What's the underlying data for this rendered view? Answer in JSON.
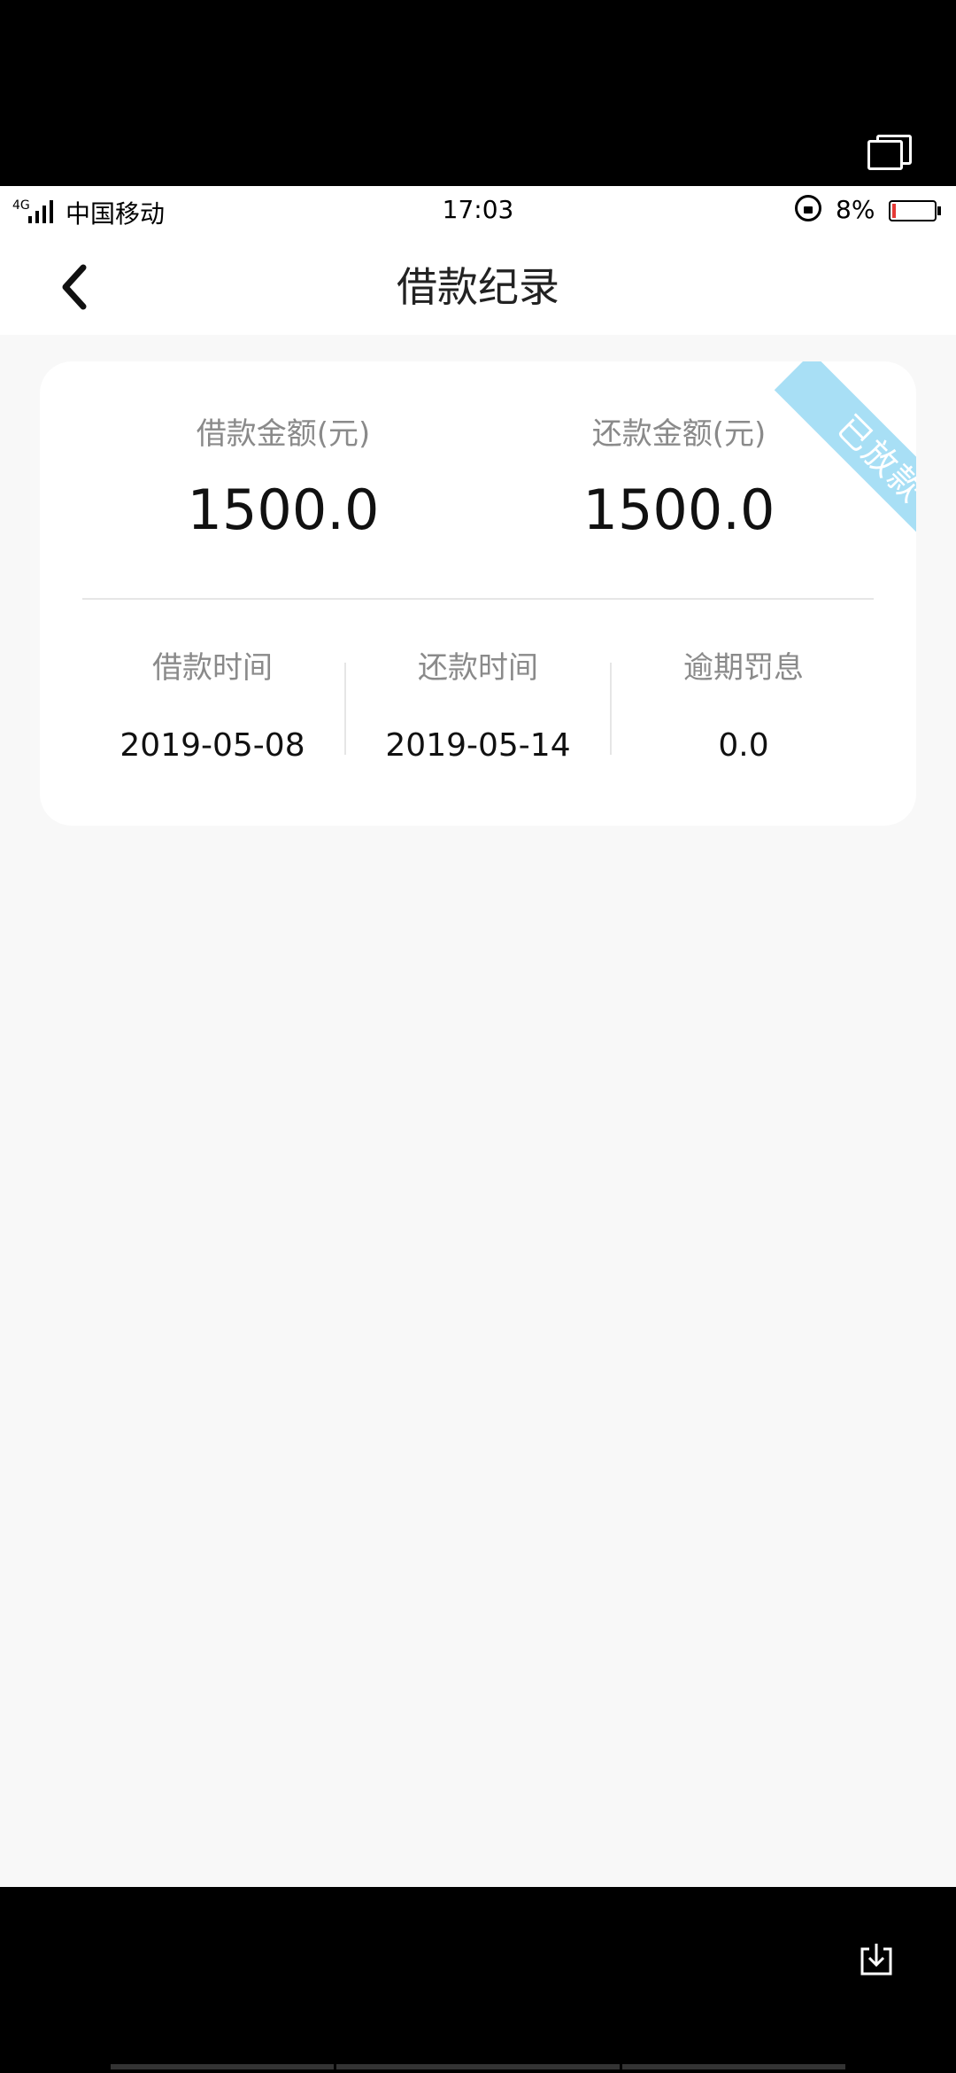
{
  "status_bar": {
    "network": "4G",
    "carrier": "中国移动",
    "time": "17:03",
    "battery": "8%",
    "battery_level": 0.08,
    "battery_color": "#e53935"
  },
  "nav": {
    "back_icon": "chevron-left-icon",
    "title": "借款纪录"
  },
  "record": {
    "status_ribbon": "已放款",
    "ribbon_color": "#a8dff5",
    "loan_amount_label": "借款金额(元)",
    "loan_amount": "1500.0",
    "repay_amount_label": "还款金额(元)",
    "repay_amount": "1500.0",
    "loan_date_label": "借款时间",
    "loan_date": "2019-05-08",
    "repay_date_label": "还款时间",
    "repay_date": "2019-05-14",
    "overdue_label": "逾期罚息",
    "overdue_value": "0.0"
  },
  "system": {
    "window_icon": "window-switch-icon",
    "download_icon": "download-icon"
  }
}
